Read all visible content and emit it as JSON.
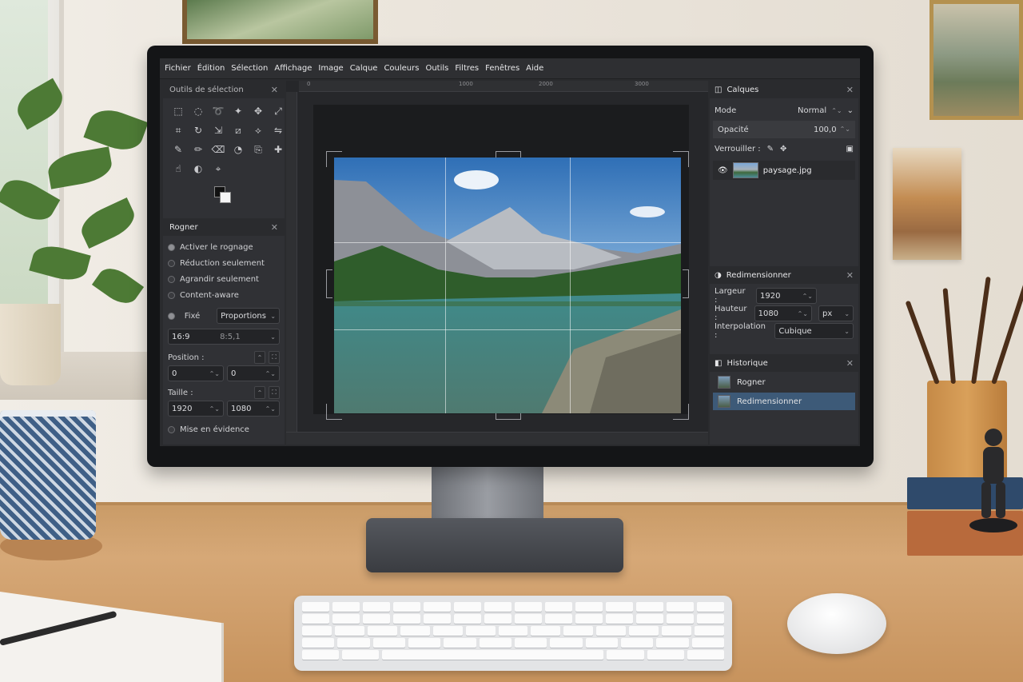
{
  "menubar": {
    "items": [
      "Fichier",
      "Édition",
      "Sélection",
      "Affichage",
      "Image",
      "Calque",
      "Couleurs",
      "Outils",
      "Filtres",
      "Fenêtres",
      "Aide"
    ]
  },
  "toolbox": {
    "title": "Outils de sélection"
  },
  "crop_panel": {
    "title": "Rogner",
    "options": [
      "Activer le rognage",
      "Réduction seulement",
      "Agrandir seulement",
      "Content-aware"
    ],
    "fixed_label": "Fixé",
    "fixed_value": "Proportions",
    "ratio_value": "16:9",
    "ratio_extra": "8:5,1",
    "position_label": "Position :",
    "position_x": "0",
    "position_y": "0",
    "size_label": "Taille :",
    "width": "1920",
    "height": "1080",
    "highlight_label": "Mise en évidence"
  },
  "rulers": {
    "ticks": [
      "0",
      "1000",
      "2000",
      "3000"
    ]
  },
  "layers_panel": {
    "title": "Calques",
    "mode_label": "Mode",
    "mode_value": "Normal",
    "opacity_label": "Opacité",
    "opacity_value": "100,0",
    "lock_label": "Verrouiller :",
    "layer_name": "paysage.jpg"
  },
  "resize_panel": {
    "title": "Redimensionner",
    "width_label": "Largeur :",
    "width_value": "1920",
    "height_label": "Hauteur :",
    "height_value": "1080",
    "unit": "px",
    "interp_label": "Interpolation :",
    "interp_value": "Cubique"
  },
  "history_panel": {
    "title": "Historique",
    "items": [
      "Rogner",
      "Redimensionner"
    ]
  },
  "colors": {
    "accent": "#3d5a78",
    "panel": "#303135"
  }
}
